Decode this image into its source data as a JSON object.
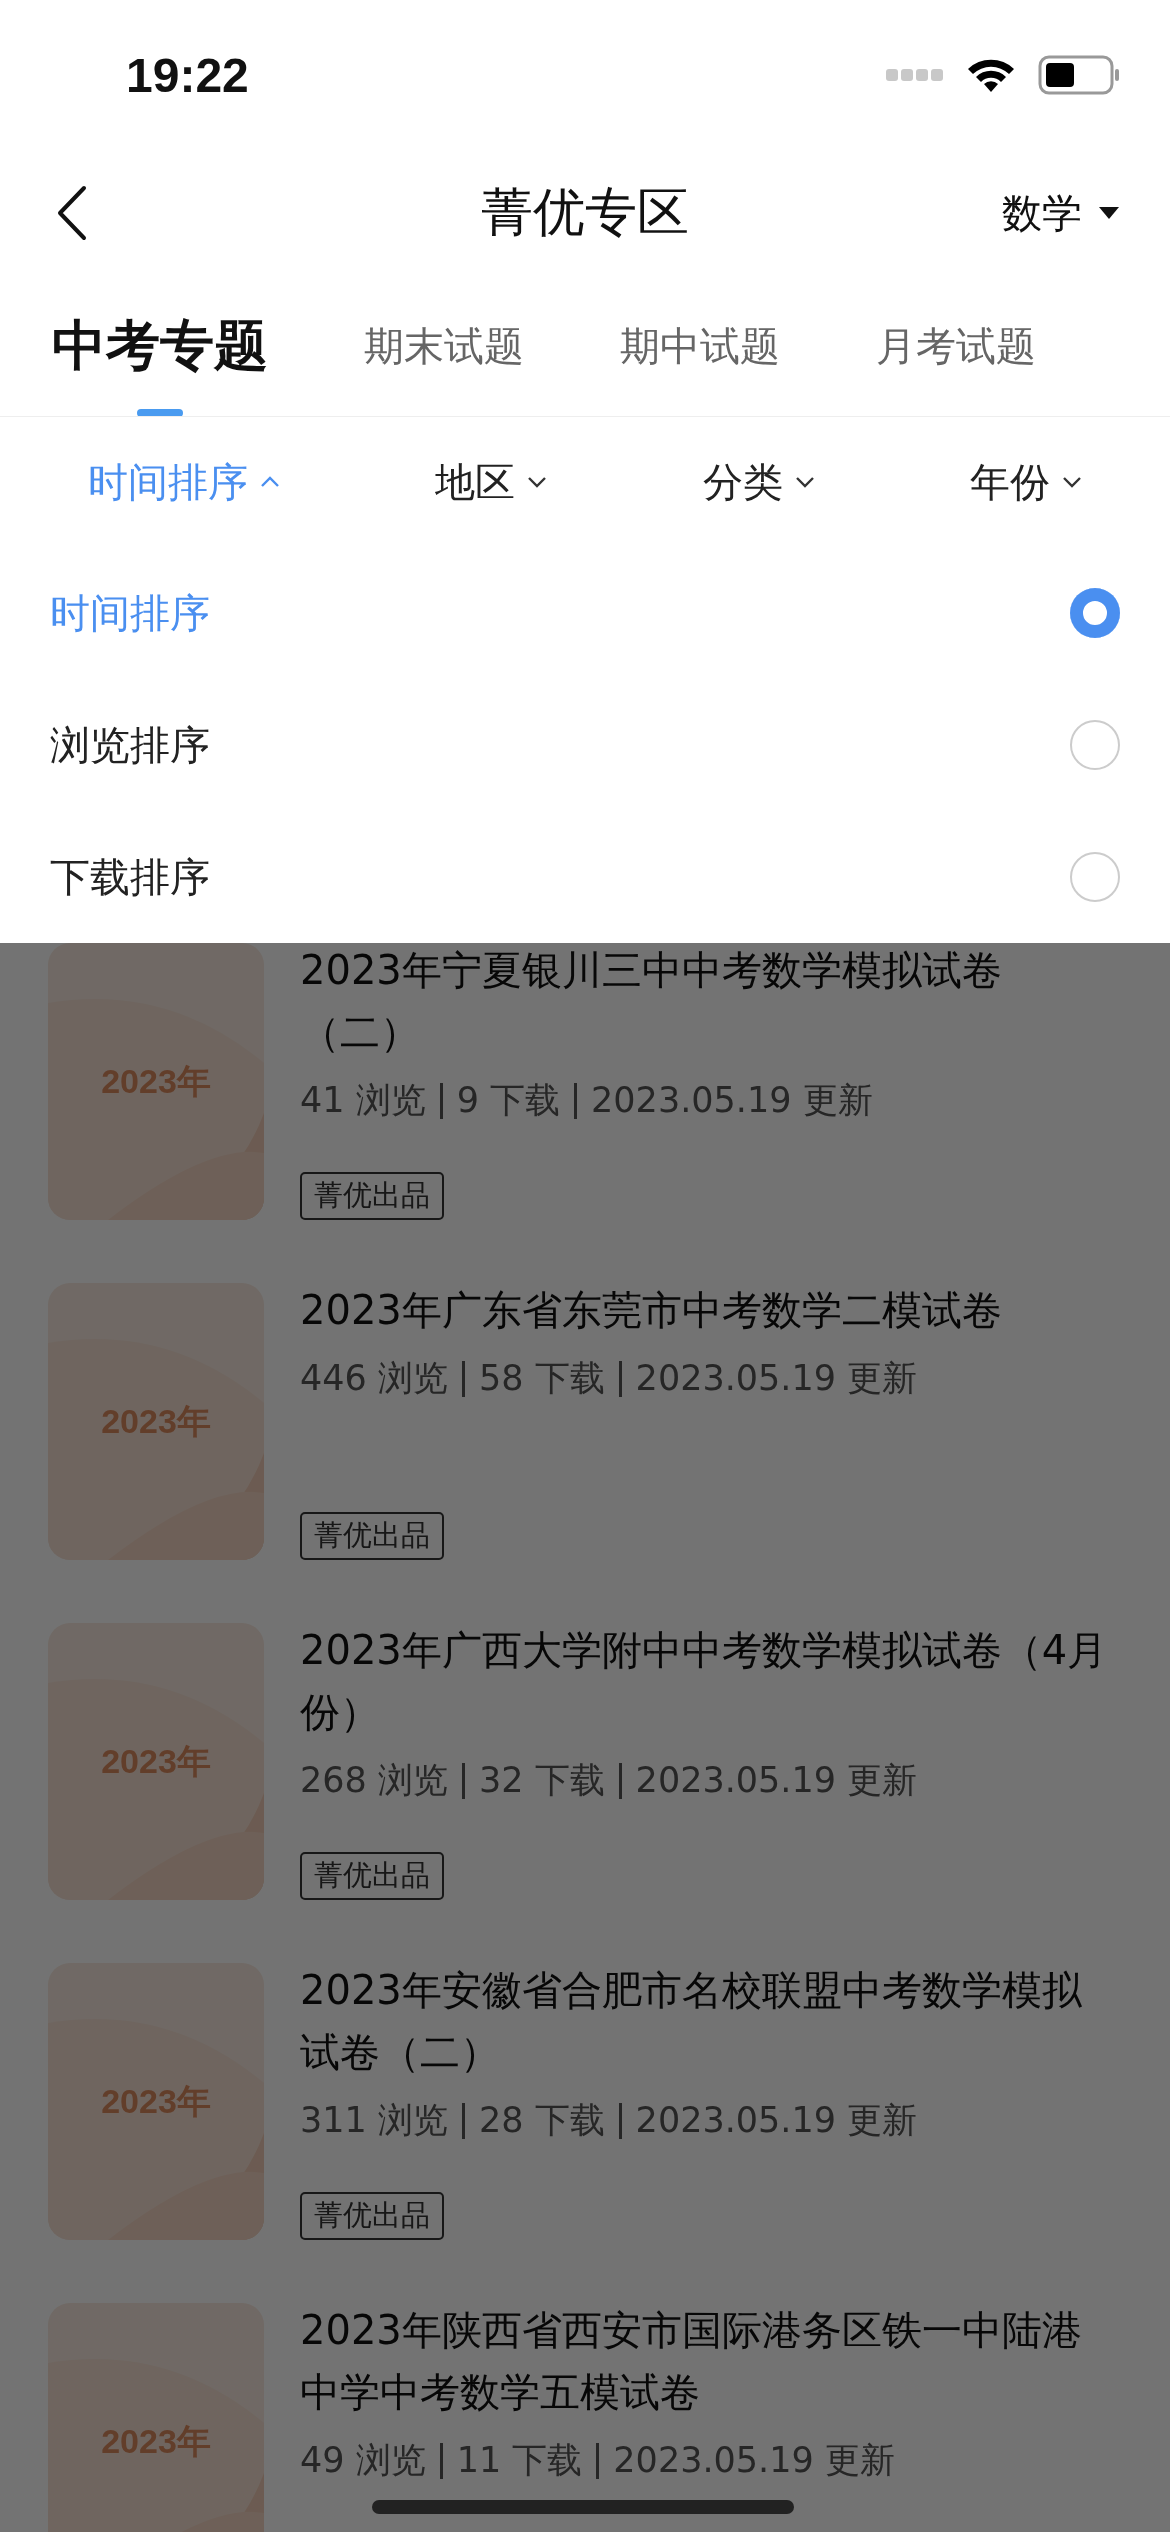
{
  "status_bar": {
    "time": "19:22"
  },
  "nav": {
    "title": "菁优专区",
    "subject": "数学"
  },
  "tabs": [
    {
      "label": "中考专题",
      "selected": true
    },
    {
      "label": "期末试题",
      "selected": false
    },
    {
      "label": "期中试题",
      "selected": false
    },
    {
      "label": "月考试题",
      "selected": false
    }
  ],
  "filters": [
    {
      "label": "时间排序",
      "selected": true
    },
    {
      "label": "地区",
      "selected": false
    },
    {
      "label": "分类",
      "selected": false
    },
    {
      "label": "年份",
      "selected": false
    }
  ],
  "sort_options": [
    {
      "label": "时间排序",
      "selected": true
    },
    {
      "label": "浏览排序",
      "selected": false
    },
    {
      "label": "下载排序",
      "selected": false
    }
  ],
  "papers": [
    {
      "cover": "2023年",
      "title": "2023年宁夏银川三中中考数学模拟试卷（二）",
      "views": "41 浏览",
      "downloads": "9 下载",
      "updated": "2023.05.19 更新",
      "tag": "菁优出品"
    },
    {
      "cover": "2023年",
      "title": "2023年广东省东莞市中考数学二模试卷",
      "views": "446 浏览",
      "downloads": "58 下载",
      "updated": "2023.05.19 更新",
      "tag": "菁优出品"
    },
    {
      "cover": "2023年",
      "title": "2023年广西大学附中中考数学模拟试卷（4月份）",
      "views": "268 浏览",
      "downloads": "32 下载",
      "updated": "2023.05.19 更新",
      "tag": "菁优出品"
    },
    {
      "cover": "2023年",
      "title": "2023年安徽省合肥市名校联盟中考数学模拟试卷（二）",
      "views": "311 浏览",
      "downloads": "28 下载",
      "updated": "2023.05.19 更新",
      "tag": "菁优出品"
    },
    {
      "cover": "2023年",
      "title": "2023年陕西省西安市国际港务区铁一中陆港中学中考数学五模试卷",
      "views": "49 浏览",
      "downloads": "11 下载",
      "updated": "2023.05.19 更新"
    }
  ]
}
